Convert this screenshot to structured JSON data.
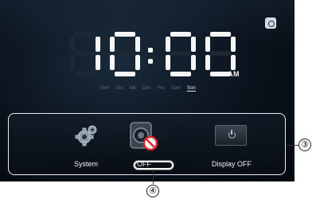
{
  "clock": {
    "time": "10:00",
    "ampm": "AM",
    "days": [
      "Mon",
      "Die",
      "Mit",
      "Don",
      "Fre",
      "Sam",
      "Son"
    ],
    "active_day": "Son"
  },
  "toolbar": {
    "system_label": "System",
    "speaker_label": "OFF",
    "display_label": "Display OFF"
  },
  "callouts": {
    "toolbar": "③",
    "off_button": "④"
  },
  "colors": {
    "screen_bg": "#0a121c",
    "digit_on": "#f4f6f8",
    "digit_off": "#1c2833",
    "frame": "#e8edf2",
    "mute_red": "#d8282c"
  }
}
